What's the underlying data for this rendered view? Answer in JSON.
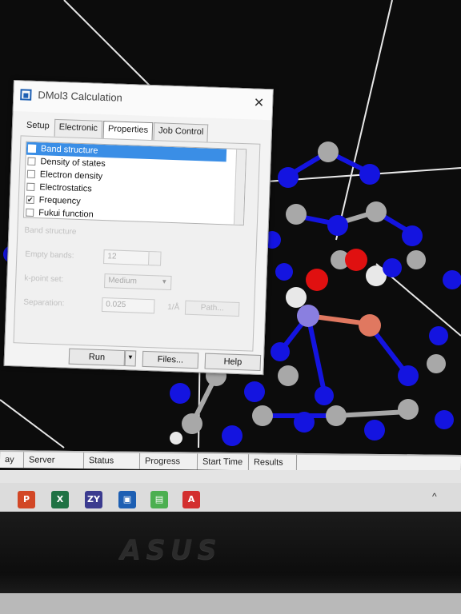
{
  "dialog": {
    "title": "DMol3 Calculation",
    "close_glyph": "✕",
    "tabs": [
      "Setup",
      "Electronic",
      "Properties",
      "Job Control"
    ],
    "properties": [
      {
        "label": "Band structure",
        "checked": false,
        "selected": true
      },
      {
        "label": "Density of states",
        "checked": false,
        "selected": false
      },
      {
        "label": "Electron density",
        "checked": false,
        "selected": false
      },
      {
        "label": "Electrostatics",
        "checked": false,
        "selected": false
      },
      {
        "label": "Frequency",
        "checked": true,
        "selected": false
      },
      {
        "label": "Fukui function",
        "checked": false,
        "selected": false
      }
    ],
    "group_title": "Band structure",
    "empty_bands_label": "Empty bands:",
    "empty_bands_value": "12",
    "kpoint_set_label": "k-point set:",
    "kpoint_set_value": "Medium",
    "separation_label": "Separation:",
    "separation_value": "0.025",
    "separation_unit": "1/Å",
    "path_button": "Path...",
    "run_button": "Run",
    "run_arrow": "▼",
    "files_button": "Files...",
    "help_button": "Help"
  },
  "job_columns": [
    "ay",
    "Server",
    "Status",
    "Progress",
    "Start Time",
    "Results"
  ],
  "taskbar_icons": [
    {
      "name": "powerpoint-icon",
      "glyph": "P",
      "color": "#d24726"
    },
    {
      "name": "excel-icon",
      "glyph": "X",
      "color": "#1f7244"
    },
    {
      "name": "zy-icon",
      "glyph": "ZY",
      "color": "#3b3b8f"
    },
    {
      "name": "materials-studio-icon",
      "glyph": "▣",
      "color": "#1d5fb3"
    },
    {
      "name": "app-green-icon",
      "glyph": "▤",
      "color": "#4caf50"
    },
    {
      "name": "acrobat-icon",
      "glyph": "A",
      "color": "#d32f2f"
    }
  ],
  "tray_glyph": "^",
  "monitor_brand": "ASUS",
  "colors": {
    "selection": "#3a8ee6",
    "nitrogen": "#1414e0",
    "carbon": "#a8a8a8",
    "oxygen": "#e01010",
    "metal": "#e07860"
  }
}
